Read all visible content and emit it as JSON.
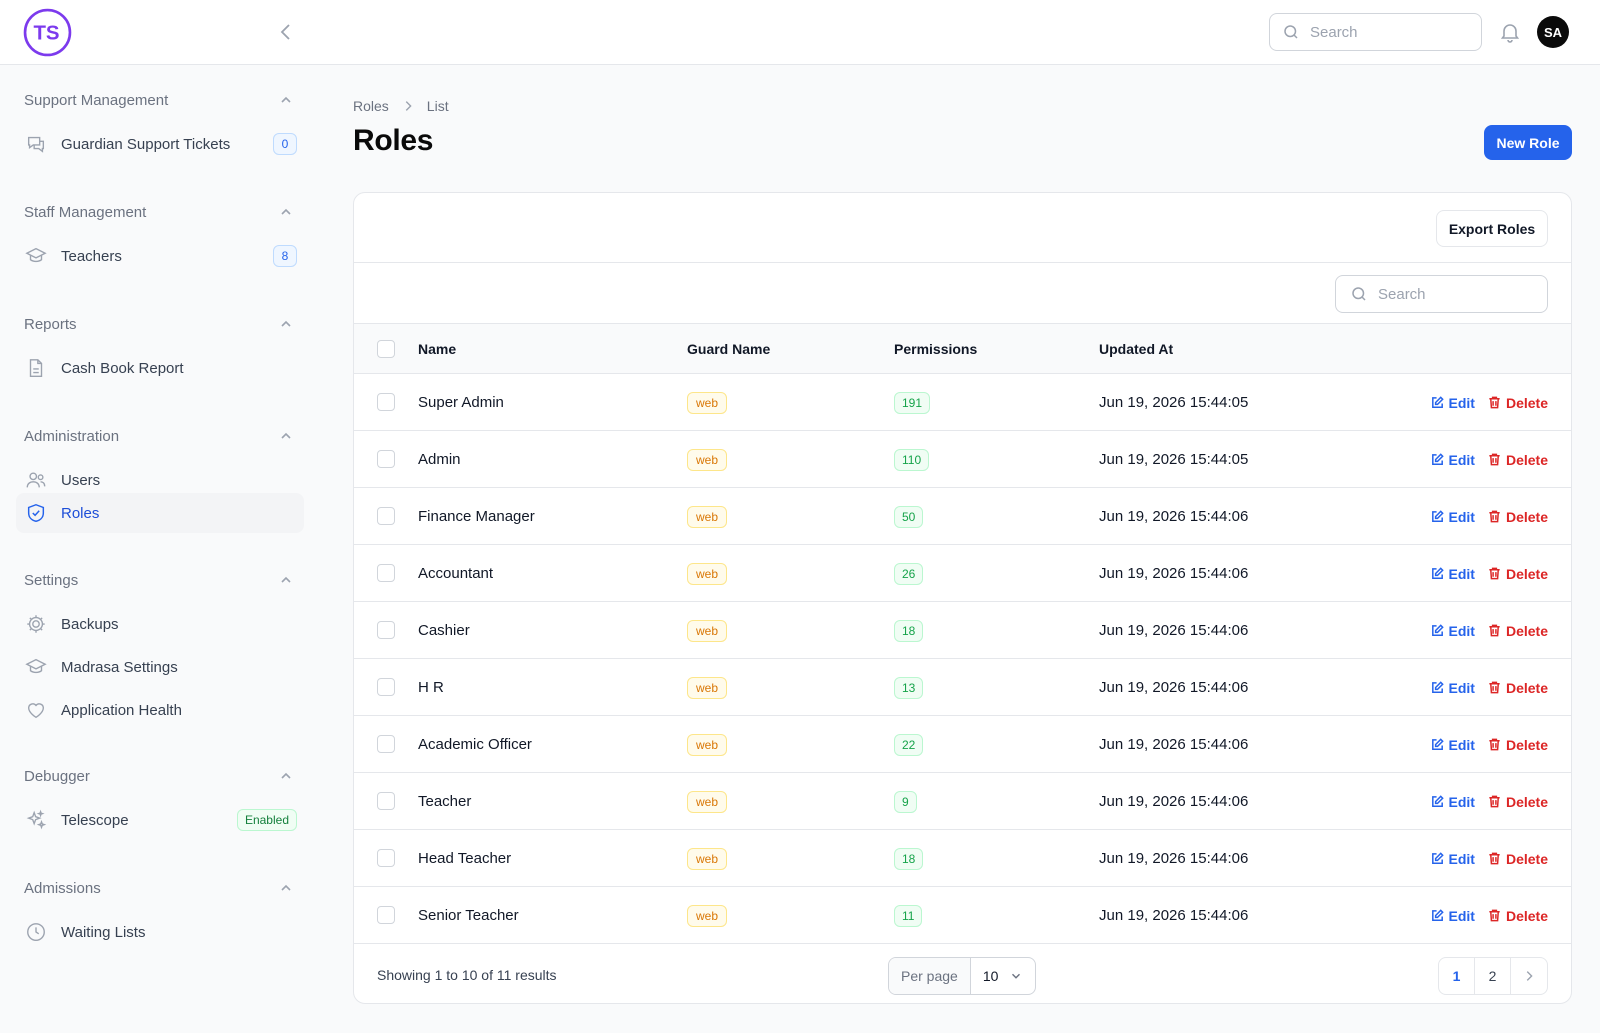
{
  "header": {
    "logo_text": "TS",
    "search_placeholder": "Search",
    "user_initials": "SA"
  },
  "sidebar": {
    "groups": [
      {
        "label": "Support Management",
        "items": [
          {
            "label": "Guardian Support Tickets",
            "icon": "chat-bubbles-icon",
            "badge": "0"
          }
        ]
      },
      {
        "label": "Staff Management",
        "items": [
          {
            "label": "Teachers",
            "icon": "academic-cap-icon",
            "badge": "8"
          }
        ]
      },
      {
        "label": "Reports",
        "items": [
          {
            "label": "Cash Book Report",
            "icon": "document-icon"
          }
        ]
      },
      {
        "label": "Administration",
        "items": [
          {
            "label": "Users",
            "icon": "users-icon"
          },
          {
            "label": "Roles",
            "icon": "shield-check-icon",
            "active": true
          }
        ]
      },
      {
        "label": "Settings",
        "items": [
          {
            "label": "Backups",
            "icon": "cog-icon"
          },
          {
            "label": "Madrasa Settings",
            "icon": "academic-cap-icon"
          },
          {
            "label": "Application Health",
            "icon": "heart-icon"
          }
        ]
      },
      {
        "label": "Debugger",
        "items": [
          {
            "label": "Telescope",
            "icon": "sparkles-icon",
            "badge": "Enabled"
          }
        ]
      },
      {
        "label": "Admissions",
        "items": [
          {
            "label": "Waiting Lists",
            "icon": "clock-icon"
          }
        ]
      }
    ]
  },
  "breadcrumb": {
    "parent": "Roles",
    "current": "List"
  },
  "page": {
    "title": "Roles",
    "new_button": "New Role"
  },
  "table": {
    "export_button": "Export Roles",
    "search_placeholder": "Search",
    "columns": {
      "name": "Name",
      "guard": "Guard Name",
      "permissions": "Permissions",
      "updated": "Updated At"
    },
    "edit_label": "Edit",
    "delete_label": "Delete",
    "rows": [
      {
        "name": "Super Admin",
        "guard": "web",
        "permissions": "191",
        "updated": "Jun 19, 2026 15:44:05"
      },
      {
        "name": "Admin",
        "guard": "web",
        "permissions": "110",
        "updated": "Jun 19, 2026 15:44:05"
      },
      {
        "name": "Finance Manager",
        "guard": "web",
        "permissions": "50",
        "updated": "Jun 19, 2026 15:44:06"
      },
      {
        "name": "Accountant",
        "guard": "web",
        "permissions": "26",
        "updated": "Jun 19, 2026 15:44:06"
      },
      {
        "name": "Cashier",
        "guard": "web",
        "permissions": "18",
        "updated": "Jun 19, 2026 15:44:06"
      },
      {
        "name": "H R",
        "guard": "web",
        "permissions": "13",
        "updated": "Jun 19, 2026 15:44:06"
      },
      {
        "name": "Academic Officer",
        "guard": "web",
        "permissions": "22",
        "updated": "Jun 19, 2026 15:44:06"
      },
      {
        "name": "Teacher",
        "guard": "web",
        "permissions": "9",
        "updated": "Jun 19, 2026 15:44:06"
      },
      {
        "name": "Head Teacher",
        "guard": "web",
        "permissions": "18",
        "updated": "Jun 19, 2026 15:44:06"
      },
      {
        "name": "Senior Teacher",
        "guard": "web",
        "permissions": "11",
        "updated": "Jun 19, 2026 15:44:06"
      }
    ],
    "footer": {
      "results_text": "Showing 1 to 10 of 11 results",
      "per_page_label": "Per page",
      "per_page_value": "10",
      "pages": [
        "1",
        "2"
      ],
      "current_page": "1"
    }
  },
  "colors": {
    "accent": "#2563eb",
    "danger": "#dc2626",
    "logo": "#7c3aed"
  }
}
